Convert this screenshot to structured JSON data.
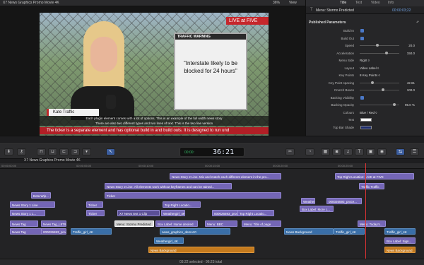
{
  "app": {
    "title": "X7 News Graphics Promo Movie 4K",
    "zoom": "36%",
    "view_label": "View"
  },
  "inspector": {
    "tabs": [
      "Title",
      "Text",
      "Video",
      "Info"
    ],
    "title_name": "Menu: Stormo Predicted",
    "timecode": "00:00:03;22",
    "section": "Published Parameters",
    "reset": "↶",
    "params": [
      {
        "label": "Build In",
        "type": "check"
      },
      {
        "label": "Build Out",
        "type": "check"
      },
      {
        "label": "Speed",
        "type": "slider",
        "value": "20.0",
        "pos": 0.45
      },
      {
        "label": "Acceleration",
        "type": "slider",
        "value": "150.0",
        "pos": 0.7
      },
      {
        "label": "Menu Side",
        "type": "text",
        "value": "Right ◊"
      },
      {
        "label": "Layout",
        "type": "text",
        "value": "Video Label ◊"
      },
      {
        "label": "Key Points",
        "type": "text",
        "value": "8 Key Points ◊"
      },
      {
        "label": "Key Point spacing",
        "type": "slider",
        "value": "42.61",
        "pos": 0.3
      },
      {
        "label": "Crunch Boxes",
        "type": "slider",
        "value": "100.0",
        "pos": 0.6
      },
      {
        "label": "Backing Visibility",
        "type": "check"
      },
      {
        "label": "Backing Opacity",
        "type": "slider",
        "value": "95.0 %",
        "pos": 0.9
      },
      {
        "label": "Colours",
        "type": "text",
        "value": "Blue / Red ◊"
      },
      {
        "label": "Text",
        "type": "swatch",
        "color": "#ffffff"
      },
      {
        "label": "Top Bar Shade",
        "type": "swatch",
        "color": "#1b2b6e"
      }
    ]
  },
  "viewer": {
    "live_badge": "LIVE at FIVE",
    "traffic_header": "TRAFFIC WARNING",
    "traffic_text": "\"Interstate likely to be blocked for 24 hours\"",
    "name_tag": "Kate Traffic",
    "story_line1": "Each plugin element comes with a lot of options. This is an example of the full width news story",
    "story_line2": "There are also two different types and two lines of text. This is the two line version",
    "ticker": "The ticker is a separate element and has optional build in and build outs. It is designed to run und"
  },
  "toolbar": {
    "timecode": "36:21",
    "tc_prefix": "00:00:"
  },
  "timeline": {
    "project": "X7 News Graphics Promo Movie 4K",
    "ruler": [
      "00:00:00:00",
      "00:00:05:00",
      "00:00:10:00",
      "00:00:15:00",
      "00:00:20:00",
      "00:00:25:00"
    ],
    "clips": [
      {
        "id": "c1",
        "label": "News Story 2 Line. Mix and match each different element in the pro...",
        "cls": "purple"
      },
      {
        "id": "c2",
        "label": "Top Right Location: LIVE at FIVE",
        "cls": "purple"
      },
      {
        "id": "c3",
        "label": "News Story 2 Line. All elements work without keyframes and can be tained...",
        "cls": "purple"
      },
      {
        "id": "c4",
        "label": "Traffic Traffic",
        "cls": "purple"
      },
      {
        "id": "c5",
        "label": "Bota Wip...",
        "cls": "purple"
      },
      {
        "id": "c6",
        "label": "Ticker",
        "cls": "purple"
      },
      {
        "id": "c7",
        "label": "News Story 1 Line",
        "cls": "purple"
      },
      {
        "id": "c8",
        "label": "Ticker: Headline News on the hour, every hour.",
        "cls": "purple"
      },
      {
        "id": "c9",
        "label": "Ticker",
        "cls": "purple"
      },
      {
        "id": "c10",
        "label": "Top Right Locatio...",
        "cls": "purple"
      },
      {
        "id": "c11",
        "label": "Weatherg...",
        "cls": "purple"
      },
      {
        "id": "c12",
        "label": "000026593_proce...",
        "cls": "purple"
      },
      {
        "id": "c13",
        "label": "News Story 1 L...",
        "cls": "purple"
      },
      {
        "id": "c14",
        "label": "Ticker",
        "cls": "purple"
      },
      {
        "id": "c15",
        "label": "X7 News text 1 Clip",
        "cls": "purple dark"
      },
      {
        "id": "c16",
        "label": "Weathergirl_4K",
        "cls": "purple"
      },
      {
        "id": "c17",
        "label": "000026593_proce...",
        "cls": "purple"
      },
      {
        "id": "c18",
        "label": "Top Right Locatio...",
        "cls": "purple"
      },
      {
        "id": "c19",
        "label": "Box Label: More c...",
        "cls": "purple"
      },
      {
        "id": "c20",
        "label": "News Tag",
        "cls": "purple"
      },
      {
        "id": "c21",
        "label": "News Tag_L8T9L8...",
        "cls": "purple"
      },
      {
        "id": "c22",
        "label": "Menu: Stormo Predicted",
        "cls": "white"
      },
      {
        "id": "c23",
        "label": "Box Label: Name desired",
        "cls": "purple"
      },
      {
        "id": "c24",
        "label": "Menu: BBC",
        "cls": "purple"
      },
      {
        "id": "c25",
        "label": "Menu: Title of page",
        "cls": "purple"
      },
      {
        "id": "c26",
        "label": "Menu: Today's...",
        "cls": "purple"
      },
      {
        "id": "c27",
        "label": "News Tag",
        "cls": "purple"
      },
      {
        "id": "c28",
        "label": "000026593_proce...",
        "cls": "purple"
      },
      {
        "id": "c29",
        "label": "Traffic_girl_4K",
        "cls": "blue"
      },
      {
        "id": "c30",
        "label": "news_graphics_demo10",
        "cls": "blue"
      },
      {
        "id": "c31",
        "label": "News Background",
        "cls": "blue"
      },
      {
        "id": "c32",
        "label": "Traffic_girl_4K",
        "cls": "blue"
      },
      {
        "id": "c33",
        "label": "Traffic_girl_4K",
        "cls": "blue"
      },
      {
        "id": "c34",
        "label": "Weathergirl_4K",
        "cls": "blue"
      },
      {
        "id": "c35",
        "label": "News Background",
        "cls": "orange"
      },
      {
        "id": "c36",
        "label": "Box Label: Sign...",
        "cls": "purple"
      },
      {
        "id": "c37",
        "label": "News Background",
        "cls": "orange"
      }
    ]
  },
  "status": {
    "text": "03:22 selected - 96:23 total"
  }
}
